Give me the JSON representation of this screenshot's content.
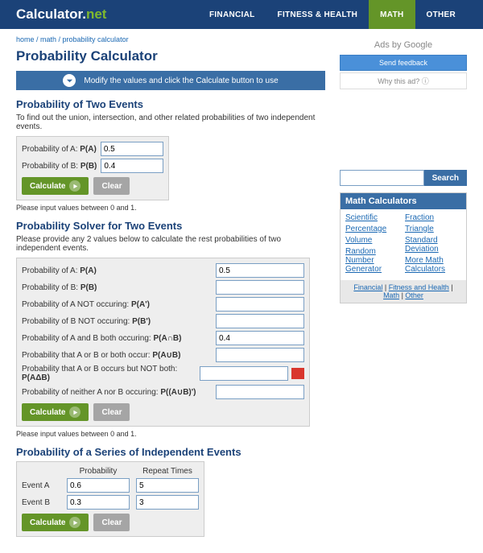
{
  "logo": {
    "main": "Calculator",
    "dot": ".",
    "tld": "net"
  },
  "nav": [
    "FINANCIAL",
    "FITNESS & HEALTH",
    "MATH",
    "OTHER"
  ],
  "breadcrumb": "home / math / probability calculator",
  "title": "Probability Calculator",
  "banner": "Modify the values and click the Calculate button to use",
  "section1": {
    "title": "Probability of Two Events",
    "desc": "To find out the union, intersection, and other related probabilities of two independent events.",
    "labelA_pre": "Probability of A: ",
    "labelA_b": "P(A)",
    "labelB_pre": "Probability of B: ",
    "labelB_b": "P(B)",
    "valA": "0.5",
    "valB": "0.4",
    "note": "Please input values between 0 and 1."
  },
  "section2": {
    "title": "Probability Solver for Two Events",
    "desc": "Please provide any 2 values below to calculate the rest probabilities of two independent events.",
    "rows": [
      {
        "pre": "Probability of A: ",
        "b": "P(A)",
        "val": "0.5"
      },
      {
        "pre": "Probability of B: ",
        "b": "P(B)",
        "val": ""
      },
      {
        "pre": "Probability of A NOT occuring: ",
        "b": "P(A')",
        "val": ""
      },
      {
        "pre": "Probability of B NOT occuring: ",
        "b": "P(B')",
        "val": ""
      },
      {
        "pre": "Probability of A and B both occuring: ",
        "b": "P(A∩B)",
        "val": "0.4"
      },
      {
        "pre": "Probability that A or B or both occur: ",
        "b": "P(A∪B)",
        "val": ""
      },
      {
        "pre": "Probability that A or B occurs but NOT both: ",
        "b": "P(AΔB)",
        "val": "",
        "icon": true
      },
      {
        "pre": "Probability of neither A nor B occuring: ",
        "b": "P((A∪B)')",
        "val": ""
      }
    ],
    "note": "Please input values between 0 and 1."
  },
  "section3": {
    "title": "Probability of a Series of Independent Events",
    "col_prob": "Probability",
    "col_rep": "Repeat Times",
    "rowA": {
      "label": "Event A",
      "prob": "0.6",
      "rep": "5"
    },
    "rowB": {
      "label": "Event B",
      "prob": "0.3",
      "rep": "3"
    }
  },
  "btn": {
    "calc": "Calculate",
    "clear": "Clear",
    "search": "Search"
  },
  "ads": {
    "title": "Ads by Google",
    "send": "Send feedback",
    "why": "Why this ad? ⓘ"
  },
  "sidepanel": {
    "title": "Math Calculators",
    "colA": [
      "Scientific",
      "Percentage",
      "Volume",
      "Random Number Generator"
    ],
    "colB": [
      "Fraction",
      "Triangle",
      "Standard Deviation",
      "More Math Calculators"
    ],
    "footer": [
      "Financial",
      "Fitness and Health",
      "Math",
      "Other"
    ]
  }
}
